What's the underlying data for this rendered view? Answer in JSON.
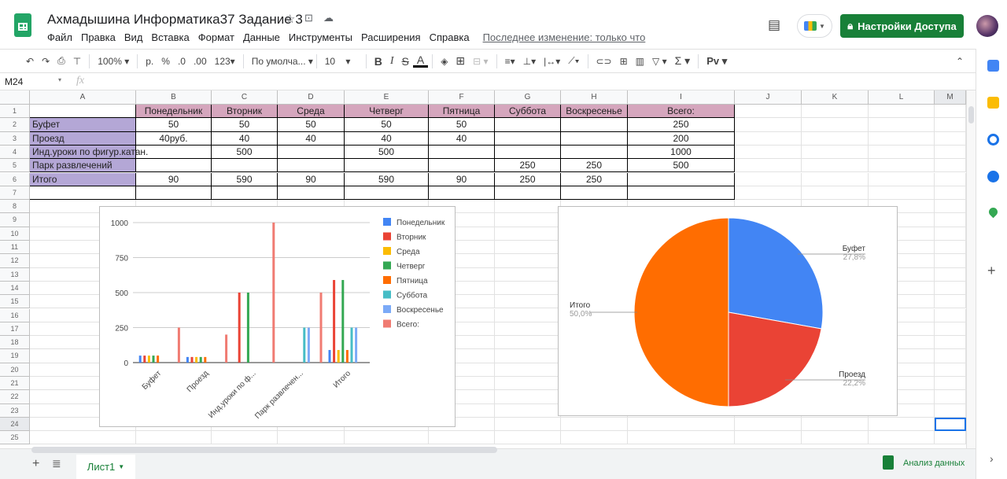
{
  "doc": {
    "title": "Ахмадышина Информатика37 Задание 3",
    "last_edit": "Последнее изменение: только что",
    "share_label": "Настройки Доступа"
  },
  "menu": [
    "Файл",
    "Правка",
    "Вид",
    "Вставка",
    "Формат",
    "Данные",
    "Инструменты",
    "Расширения",
    "Справка"
  ],
  "toolbar": {
    "zoom": "100%",
    "currency": "р.",
    "percent": "%",
    "dec_less": ".0",
    "dec_more": ".00",
    "format": "123",
    "font": "По умолча...",
    "font_size": "10",
    "bold": "B",
    "italic": "I",
    "strike": "S",
    "text_color": "A",
    "sum": "Σ",
    "input_tools": "Pv"
  },
  "formula_bar": {
    "cell_ref": "M24",
    "fx": "fx",
    "value": ""
  },
  "columns": [
    "A",
    "B",
    "C",
    "D",
    "E",
    "F",
    "G",
    "H",
    "I",
    "J",
    "K",
    "L",
    "M"
  ],
  "rows": [
    "1",
    "2",
    "3",
    "4",
    "5",
    "6",
    "7",
    "8",
    "9",
    "10",
    "11",
    "12",
    "13",
    "14",
    "15",
    "16",
    "17",
    "18",
    "19",
    "20",
    "21",
    "22",
    "23",
    "24",
    "25"
  ],
  "table": [
    [
      "",
      "Понедельник",
      "Вторник",
      "Среда",
      "Четверг",
      "Пятница",
      "Суббота",
      "Воскресенье",
      "Всего:"
    ],
    [
      "Буфет",
      "50",
      "50",
      "50",
      "50",
      "50",
      "",
      "",
      "250"
    ],
    [
      "Проезд",
      "40руб.",
      "40",
      "40",
      "40",
      "40",
      "",
      "",
      "200"
    ],
    [
      "Инд.уроки по фигур.катан.",
      "",
      "500",
      "",
      "500",
      "",
      "",
      "",
      "1000"
    ],
    [
      "Парк развлечений",
      "",
      "",
      "",
      "",
      "",
      "250",
      "250",
      "500"
    ],
    [
      "Итого",
      "90",
      "590",
      "90",
      "590",
      "90",
      "250",
      "250",
      ""
    ],
    [
      "",
      "",
      "",
      "",
      "",
      "",
      "",
      "",
      ""
    ]
  ],
  "colors": {
    "header_fill": "#d5a6bd",
    "label_fill": "#b4a7d6",
    "accent": "#188038"
  },
  "sheet": {
    "tab": "Лист1",
    "explore": "Анализ данных"
  },
  "chart_data": [
    {
      "type": "bar",
      "title": "",
      "categories": [
        "Буфет",
        "Проезд",
        "Инд.уроки по ф...",
        "Парк развлечен...",
        "Итого"
      ],
      "ylim": [
        0,
        1000
      ],
      "yticks": [
        "0",
        "250",
        "500",
        "750",
        "1000"
      ],
      "legend_position": "right",
      "series": [
        {
          "name": "Понедельник",
          "color": "#4285f4",
          "values": [
            50,
            40,
            0,
            0,
            90
          ]
        },
        {
          "name": "Вторник",
          "color": "#ea4335",
          "values": [
            50,
            40,
            500,
            0,
            590
          ]
        },
        {
          "name": "Среда",
          "color": "#fbbc04",
          "values": [
            50,
            40,
            0,
            0,
            90
          ]
        },
        {
          "name": "Четверг",
          "color": "#34a853",
          "values": [
            50,
            40,
            500,
            0,
            590
          ]
        },
        {
          "name": "Пятница",
          "color": "#ff6d01",
          "values": [
            50,
            40,
            0,
            0,
            90
          ]
        },
        {
          "name": "Суббота",
          "color": "#46bdc6",
          "values": [
            0,
            0,
            0,
            250,
            250
          ]
        },
        {
          "name": "Воскресенье",
          "color": "#7baaf7",
          "values": [
            0,
            0,
            0,
            250,
            250
          ]
        },
        {
          "name": "Всего:",
          "color": "#f07b72",
          "values": [
            250,
            200,
            1000,
            500,
            0
          ]
        }
      ]
    },
    {
      "type": "pie",
      "slices": [
        {
          "label": "Буфет",
          "pct": "27,8%",
          "value": 27.8,
          "color": "#4285f4"
        },
        {
          "label": "Проезд",
          "pct": "22,2%",
          "value": 22.2,
          "color": "#ea4335"
        },
        {
          "label": "Итого",
          "pct": "50,0%",
          "value": 50,
          "color": "#ff6d01"
        }
      ]
    }
  ]
}
